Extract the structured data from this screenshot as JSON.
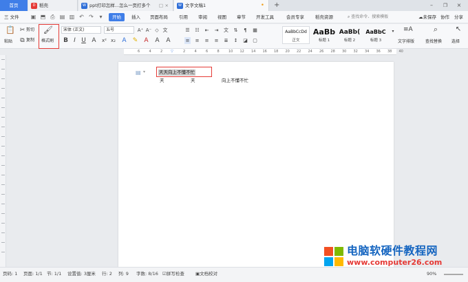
{
  "tabs": [
    {
      "label": "首页"
    },
    {
      "label": "稻壳",
      "icon": "docer"
    },
    {
      "label": "ppt打印怎样...怎么一页打多个",
      "icon": "ppt"
    },
    {
      "label": "文字文稿1",
      "icon": "wps-writer",
      "active": true
    }
  ],
  "new_tab": "+",
  "menubar": {
    "file": "三 文件",
    "items": [
      "开始",
      "插入",
      "页面布局",
      "引用",
      "审阅",
      "视图",
      "章节",
      "开发工具",
      "会员专享",
      "稻壳资源"
    ],
    "active_item": "开始",
    "search_placeholder": "查找命令、搜索模板",
    "unsaved": "未保存",
    "collab": "协作",
    "share": "分享"
  },
  "ribbon": {
    "paste": "粘贴",
    "cut": "剪切",
    "copy": "复制",
    "format_painter": "格式刷",
    "font_name": "宋体 (正文)",
    "font_size": "五号",
    "styles": [
      {
        "sample": "AaBbCcDd",
        "name": "正文"
      },
      {
        "sample": "AaBb",
        "name": "标题 1"
      },
      {
        "sample": "AaBb(",
        "name": "标题 2"
      },
      {
        "sample": "AaBbC",
        "name": "标题 3"
      }
    ],
    "text_layout": "文字排版",
    "find_replace": "查找替换",
    "select": "选择"
  },
  "ruler": [
    "6",
    "4",
    "2",
    "",
    "2",
    "4",
    "6",
    "8",
    "10",
    "12",
    "14",
    "16",
    "18",
    "20",
    "22",
    "24",
    "26",
    "28",
    "30",
    "32",
    "34",
    "36",
    "38",
    "40"
  ],
  "document": {
    "selected_line": "天天向上不懂不忙",
    "line2_col1": "天",
    "line2_col2": "天",
    "line2_col3": "向上不懂不忙"
  },
  "status": {
    "page_num": "页码: 1",
    "page": "页面: 1/1",
    "section": "节: 1/1",
    "setting": "设置值: 3厘米",
    "row": "行: 2",
    "col": "列: 9",
    "words": "字数: 8/16",
    "spellcheck": "拼写检查",
    "proofread": "文档校对",
    "zoom": "90%"
  },
  "watermark": {
    "title": "电脑软硬件教程网",
    "url": "www.computer26.com"
  },
  "colors": {
    "accent": "#3f7ee8",
    "highlight": "#e53935"
  }
}
